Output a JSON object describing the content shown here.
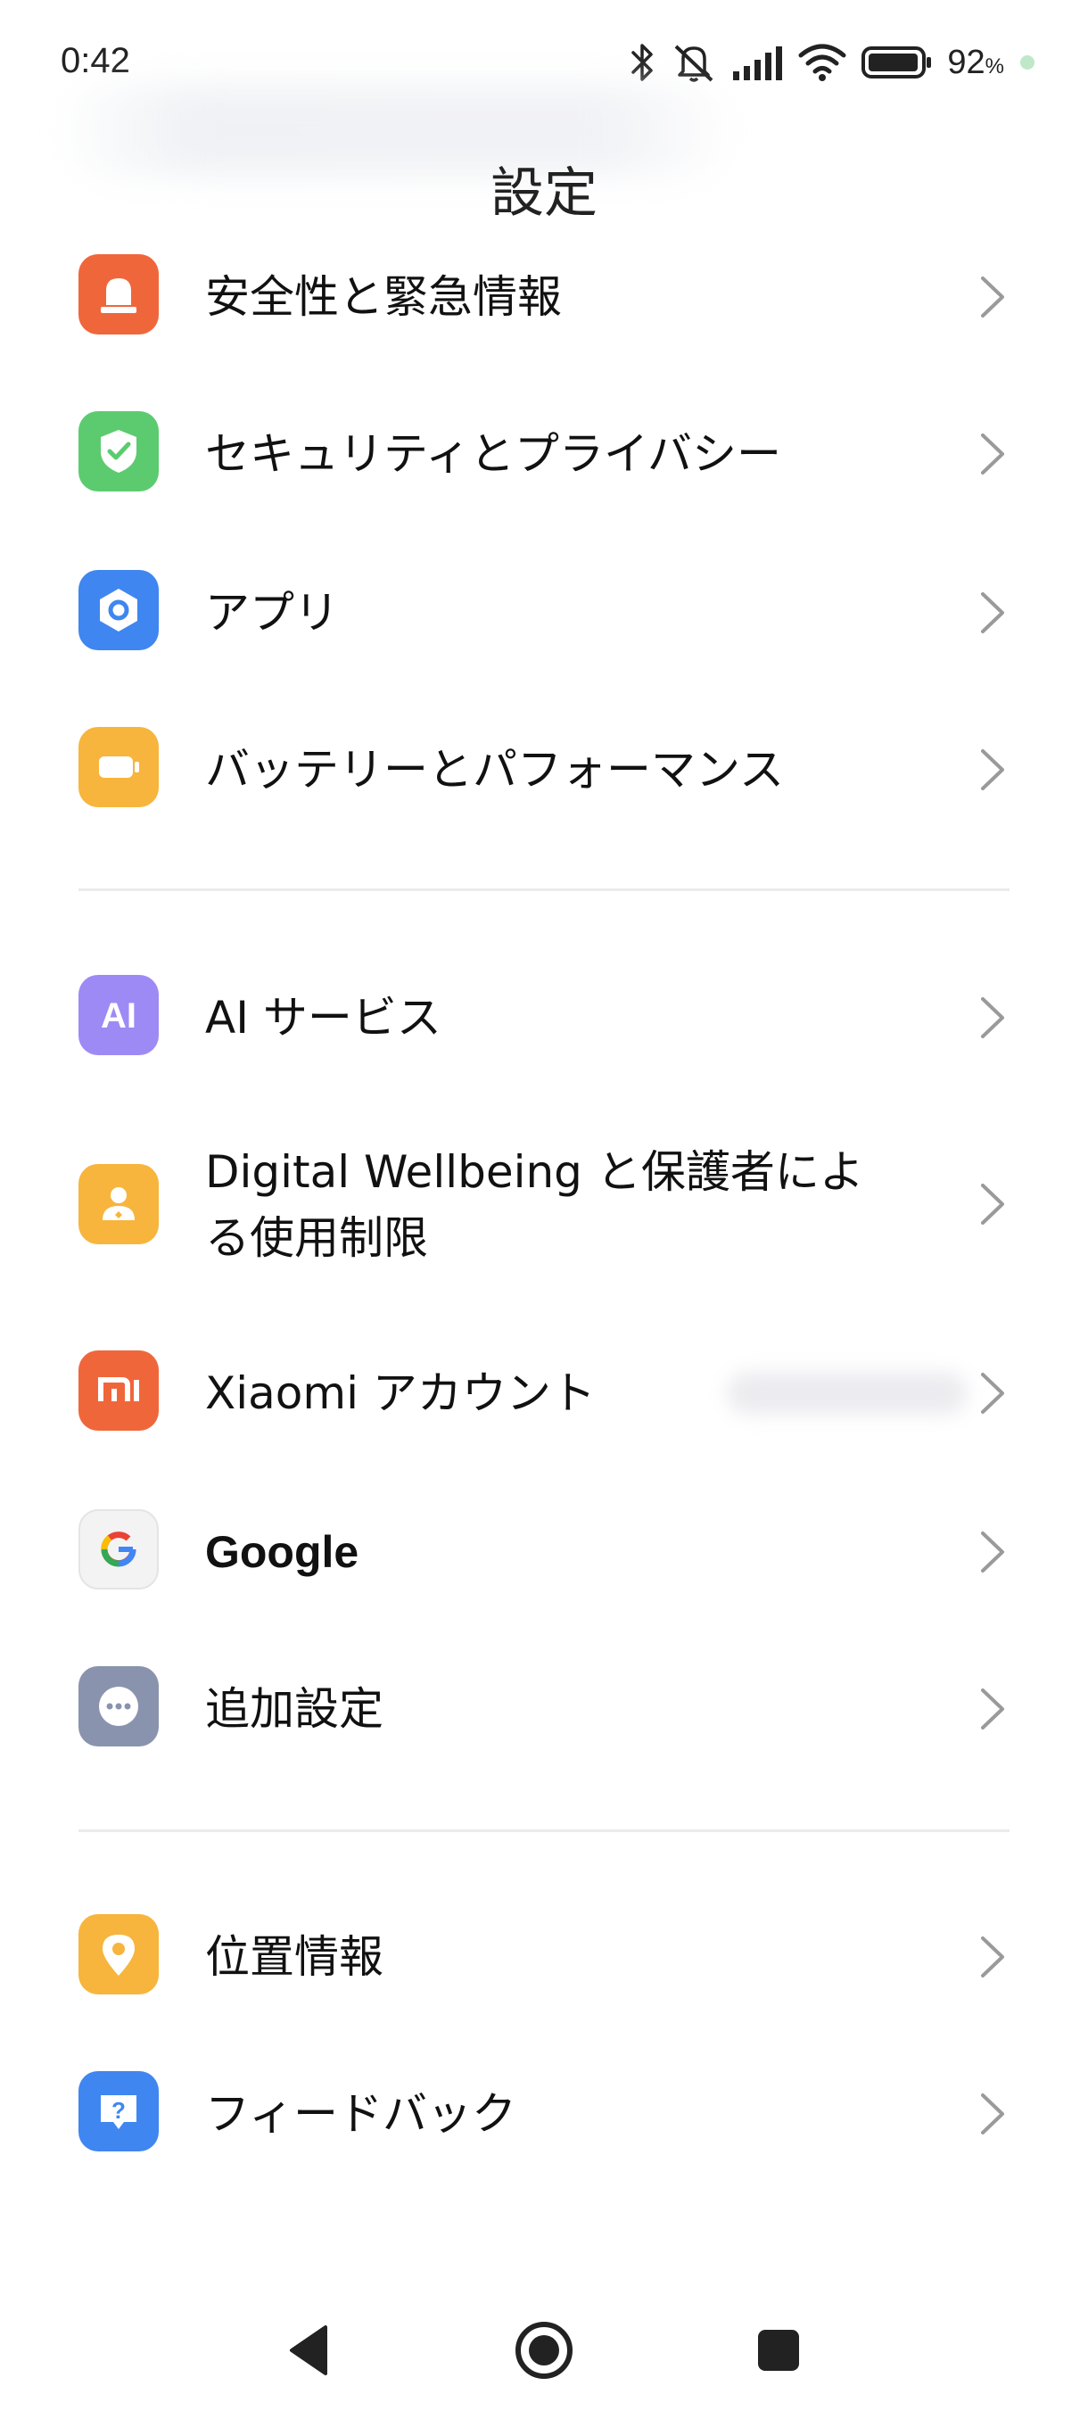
{
  "status_bar": {
    "time": "0:42",
    "battery_percent": "92",
    "battery_unit": "%",
    "icons": [
      "bluetooth-icon",
      "mute-icon",
      "signal-icon",
      "wifi-icon",
      "battery-icon"
    ]
  },
  "header": {
    "title": "設定"
  },
  "sections": [
    {
      "items": [
        {
          "label": "安全性と緊急情報",
          "icon": "emergency-light-icon",
          "color": "#F0663B"
        },
        {
          "label": "セキュリティとプライバシー",
          "icon": "shield-check-icon",
          "color": "#5CCB70"
        },
        {
          "label": "アプリ",
          "icon": "apps-hexagon-icon",
          "color": "#3F86F0"
        },
        {
          "label": "バッテリーとパフォーマンス",
          "icon": "battery-icon",
          "color": "#F7B53D"
        }
      ]
    },
    {
      "items": [
        {
          "label": "AI サービス",
          "icon": "ai-icon",
          "color": "#9E8AF5"
        },
        {
          "label_line1": "Digital Wellbeing と保護者によ",
          "label_line2": "る使用制限",
          "icon": "wellbeing-person-icon",
          "color": "#F7B53D"
        },
        {
          "label": "Xiaomi アカウント",
          "icon": "mi-logo-icon",
          "color": "#F0663B"
        },
        {
          "label": "Google",
          "icon": "google-icon",
          "color": "#F3F3F3"
        },
        {
          "label": "追加設定",
          "icon": "more-dots-icon",
          "color": "#8A93AE"
        }
      ]
    },
    {
      "items": [
        {
          "label": "位置情報",
          "icon": "location-pin-icon",
          "color": "#F7B53D"
        },
        {
          "label": "フィードバック",
          "icon": "feedback-question-icon",
          "color": "#3F86F0"
        }
      ]
    }
  ],
  "nav_bar": {
    "buttons": [
      "back-icon",
      "home-icon",
      "recents-icon"
    ]
  }
}
